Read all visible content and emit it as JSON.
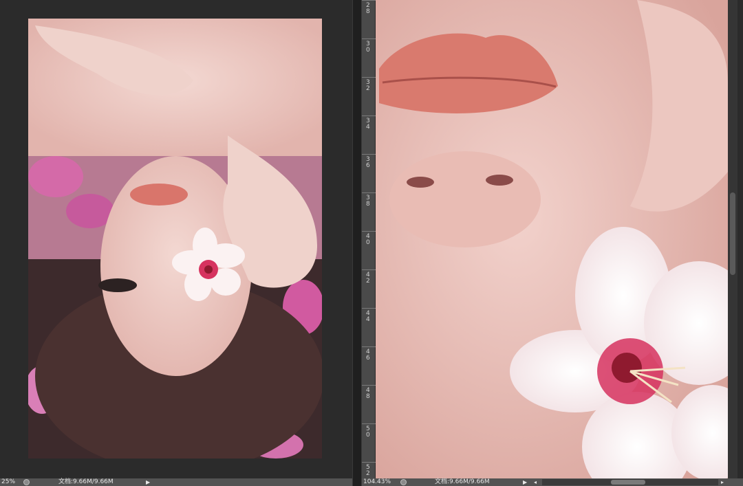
{
  "left_doc": {
    "zoom": "25%",
    "doc_info": "文档:9.66M/9.66M",
    "arrow": "▶"
  },
  "right_doc": {
    "zoom": "104.43%",
    "doc_info": "文档:9.66M/9.66M",
    "arrow": "▶",
    "scroll_left": "◂",
    "scroll_right": "▸",
    "ruler_ticks": [
      "28",
      "30",
      "32",
      "34",
      "36",
      "38",
      "40",
      "42",
      "44",
      "46",
      "48",
      "50",
      "52"
    ]
  },
  "colors": {
    "workspace": "#2b2b2b",
    "statusbar": "#535353",
    "ruler": "#4a4a4a"
  },
  "icons": [
    "document-status-icon",
    "play-arrow-icon",
    "scroll-left-icon",
    "scroll-right-icon"
  ]
}
